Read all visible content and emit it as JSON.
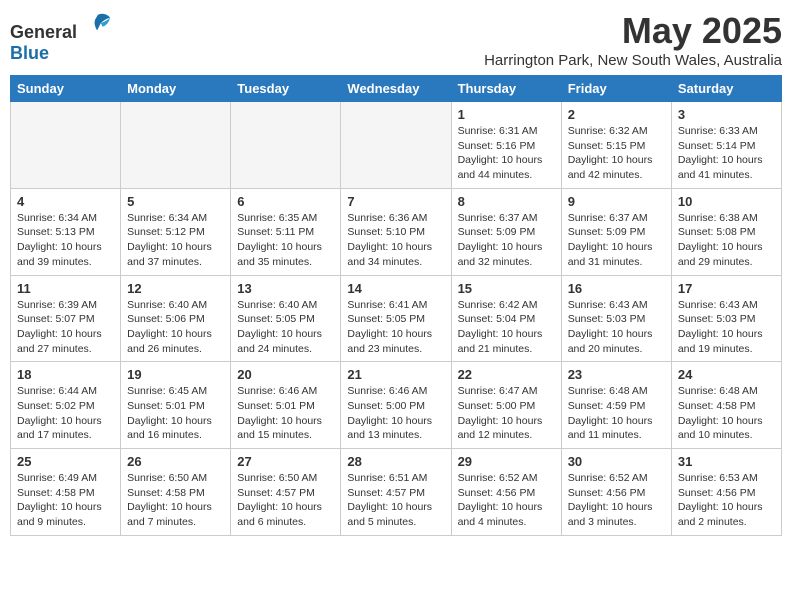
{
  "header": {
    "logo_general": "General",
    "logo_blue": "Blue",
    "month_title": "May 2025",
    "location": "Harrington Park, New South Wales, Australia"
  },
  "days_of_week": [
    "Sunday",
    "Monday",
    "Tuesday",
    "Wednesday",
    "Thursday",
    "Friday",
    "Saturday"
  ],
  "weeks": [
    [
      {
        "day": "",
        "info": ""
      },
      {
        "day": "",
        "info": ""
      },
      {
        "day": "",
        "info": ""
      },
      {
        "day": "",
        "info": ""
      },
      {
        "day": "1",
        "info": "Sunrise: 6:31 AM\nSunset: 5:16 PM\nDaylight: 10 hours\nand 44 minutes."
      },
      {
        "day": "2",
        "info": "Sunrise: 6:32 AM\nSunset: 5:15 PM\nDaylight: 10 hours\nand 42 minutes."
      },
      {
        "day": "3",
        "info": "Sunrise: 6:33 AM\nSunset: 5:14 PM\nDaylight: 10 hours\nand 41 minutes."
      }
    ],
    [
      {
        "day": "4",
        "info": "Sunrise: 6:34 AM\nSunset: 5:13 PM\nDaylight: 10 hours\nand 39 minutes."
      },
      {
        "day": "5",
        "info": "Sunrise: 6:34 AM\nSunset: 5:12 PM\nDaylight: 10 hours\nand 37 minutes."
      },
      {
        "day": "6",
        "info": "Sunrise: 6:35 AM\nSunset: 5:11 PM\nDaylight: 10 hours\nand 35 minutes."
      },
      {
        "day": "7",
        "info": "Sunrise: 6:36 AM\nSunset: 5:10 PM\nDaylight: 10 hours\nand 34 minutes."
      },
      {
        "day": "8",
        "info": "Sunrise: 6:37 AM\nSunset: 5:09 PM\nDaylight: 10 hours\nand 32 minutes."
      },
      {
        "day": "9",
        "info": "Sunrise: 6:37 AM\nSunset: 5:09 PM\nDaylight: 10 hours\nand 31 minutes."
      },
      {
        "day": "10",
        "info": "Sunrise: 6:38 AM\nSunset: 5:08 PM\nDaylight: 10 hours\nand 29 minutes."
      }
    ],
    [
      {
        "day": "11",
        "info": "Sunrise: 6:39 AM\nSunset: 5:07 PM\nDaylight: 10 hours\nand 27 minutes."
      },
      {
        "day": "12",
        "info": "Sunrise: 6:40 AM\nSunset: 5:06 PM\nDaylight: 10 hours\nand 26 minutes."
      },
      {
        "day": "13",
        "info": "Sunrise: 6:40 AM\nSunset: 5:05 PM\nDaylight: 10 hours\nand 24 minutes."
      },
      {
        "day": "14",
        "info": "Sunrise: 6:41 AM\nSunset: 5:05 PM\nDaylight: 10 hours\nand 23 minutes."
      },
      {
        "day": "15",
        "info": "Sunrise: 6:42 AM\nSunset: 5:04 PM\nDaylight: 10 hours\nand 21 minutes."
      },
      {
        "day": "16",
        "info": "Sunrise: 6:43 AM\nSunset: 5:03 PM\nDaylight: 10 hours\nand 20 minutes."
      },
      {
        "day": "17",
        "info": "Sunrise: 6:43 AM\nSunset: 5:03 PM\nDaylight: 10 hours\nand 19 minutes."
      }
    ],
    [
      {
        "day": "18",
        "info": "Sunrise: 6:44 AM\nSunset: 5:02 PM\nDaylight: 10 hours\nand 17 minutes."
      },
      {
        "day": "19",
        "info": "Sunrise: 6:45 AM\nSunset: 5:01 PM\nDaylight: 10 hours\nand 16 minutes."
      },
      {
        "day": "20",
        "info": "Sunrise: 6:46 AM\nSunset: 5:01 PM\nDaylight: 10 hours\nand 15 minutes."
      },
      {
        "day": "21",
        "info": "Sunrise: 6:46 AM\nSunset: 5:00 PM\nDaylight: 10 hours\nand 13 minutes."
      },
      {
        "day": "22",
        "info": "Sunrise: 6:47 AM\nSunset: 5:00 PM\nDaylight: 10 hours\nand 12 minutes."
      },
      {
        "day": "23",
        "info": "Sunrise: 6:48 AM\nSunset: 4:59 PM\nDaylight: 10 hours\nand 11 minutes."
      },
      {
        "day": "24",
        "info": "Sunrise: 6:48 AM\nSunset: 4:58 PM\nDaylight: 10 hours\nand 10 minutes."
      }
    ],
    [
      {
        "day": "25",
        "info": "Sunrise: 6:49 AM\nSunset: 4:58 PM\nDaylight: 10 hours\nand 9 minutes."
      },
      {
        "day": "26",
        "info": "Sunrise: 6:50 AM\nSunset: 4:58 PM\nDaylight: 10 hours\nand 7 minutes."
      },
      {
        "day": "27",
        "info": "Sunrise: 6:50 AM\nSunset: 4:57 PM\nDaylight: 10 hours\nand 6 minutes."
      },
      {
        "day": "28",
        "info": "Sunrise: 6:51 AM\nSunset: 4:57 PM\nDaylight: 10 hours\nand 5 minutes."
      },
      {
        "day": "29",
        "info": "Sunrise: 6:52 AM\nSunset: 4:56 PM\nDaylight: 10 hours\nand 4 minutes."
      },
      {
        "day": "30",
        "info": "Sunrise: 6:52 AM\nSunset: 4:56 PM\nDaylight: 10 hours\nand 3 minutes."
      },
      {
        "day": "31",
        "info": "Sunrise: 6:53 AM\nSunset: 4:56 PM\nDaylight: 10 hours\nand 2 minutes."
      }
    ]
  ]
}
